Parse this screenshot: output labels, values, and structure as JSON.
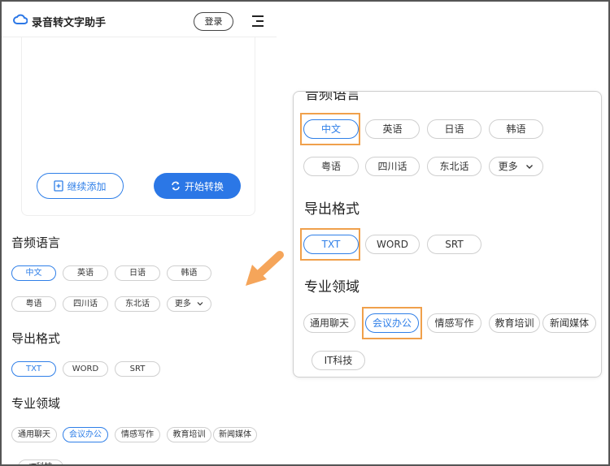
{
  "header": {
    "app_title": "录音转文字助手",
    "login_label": "登录"
  },
  "upload": {
    "add_label": "继续添加",
    "start_label": "开始转换"
  },
  "sections": {
    "language_title": "音频语言",
    "format_title": "导出格式",
    "domain_title": "专业领域"
  },
  "languages": [
    "中文",
    "英语",
    "日语",
    "韩语",
    "粤语",
    "四川话",
    "东北话",
    "更多"
  ],
  "formats": [
    "TXT",
    "WORD",
    "SRT"
  ],
  "domains": [
    "通用聊天",
    "会议办公",
    "情感写作",
    "教育培训",
    "新闻媒体",
    "IT科技"
  ],
  "selected": {
    "language": "中文",
    "format": "TXT",
    "domain": "会议办公"
  },
  "zoom": {
    "language_title_partial": "音频语言"
  },
  "colors": {
    "accent": "#2b77e6",
    "highlight": "#f0a04b",
    "arrow": "#f5a55a"
  }
}
